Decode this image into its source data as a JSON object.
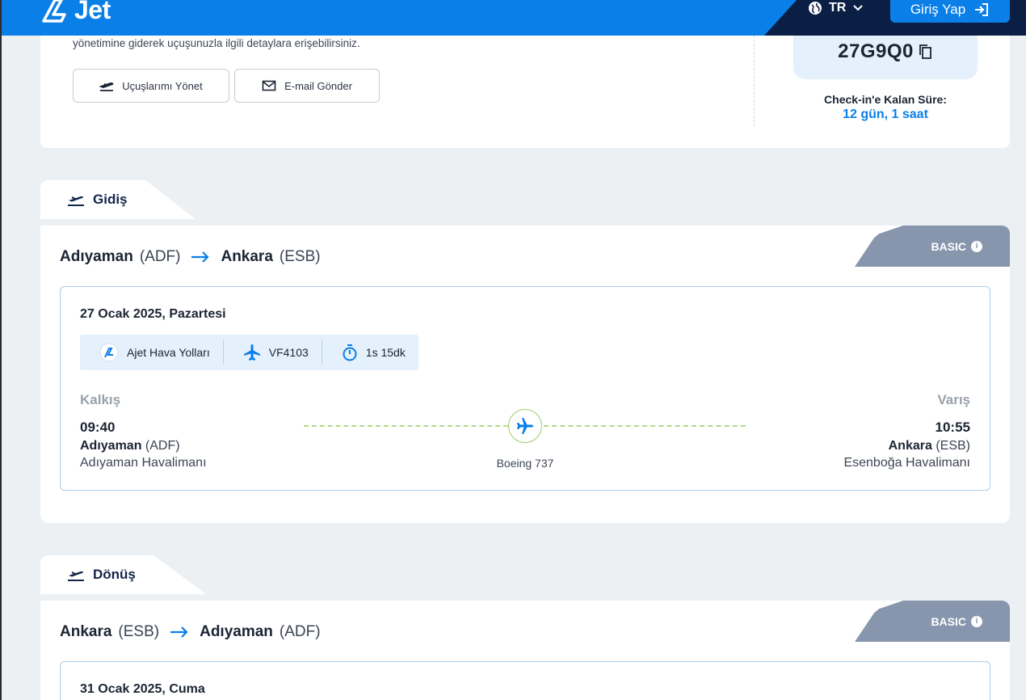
{
  "header": {
    "logo_text": "Jet",
    "language": "TR",
    "login_label": "Giriş Yap"
  },
  "top": {
    "description": "yönetimine giderek uçuşunuzla ilgili detaylara erişebilirsiniz.",
    "manage_label": "Uçuşlarımı Yönet",
    "email_label": "E-mail Gönder",
    "pnr": "27G9Q0",
    "checkin_label": "Check-in'e Kalan Süre:",
    "checkin_value": "12 gün, 1 saat"
  },
  "outbound": {
    "tab_label": "Gidiş",
    "from_city": "Adıyaman",
    "from_code": "(ADF)",
    "to_city": "Ankara",
    "to_code": "(ESB)",
    "fare": "BASIC",
    "date": "27 Ocak 2025, Pazartesi",
    "airline": "Ajet Hava Yolları",
    "flight_no": "VF4103",
    "duration": "1s 15dk",
    "dep_label": "Kalkış",
    "arr_label": "Varış",
    "dep_time": "09:40",
    "arr_time": "10:55",
    "dep_city": "Adıyaman",
    "dep_code": "(ADF)",
    "arr_city": "Ankara",
    "arr_code": "(ESB)",
    "dep_airport": "Adıyaman Havalimanı",
    "arr_airport": "Esenboğa Havalimanı",
    "aircraft": "Boeing 737"
  },
  "return": {
    "tab_label": "Dönüş",
    "from_city": "Ankara",
    "from_code": "(ESB)",
    "to_city": "Adıyaman",
    "to_code": "(ADF)",
    "fare": "BASIC",
    "date": "31 Ocak 2025, Cuma"
  },
  "colors": {
    "brand_blue": "#0a7fe8",
    "navy": "#0b1f45",
    "fare_tag": "#8795ad",
    "route_green": "#b5dc8a"
  },
  "icons": [
    "globe-icon",
    "chevron-down-icon",
    "login-icon",
    "plane-takeoff-icon",
    "mail-icon",
    "copy-icon",
    "arrow-right-icon",
    "info-icon",
    "airline-logo-icon",
    "plane-icon",
    "stopwatch-icon"
  ]
}
